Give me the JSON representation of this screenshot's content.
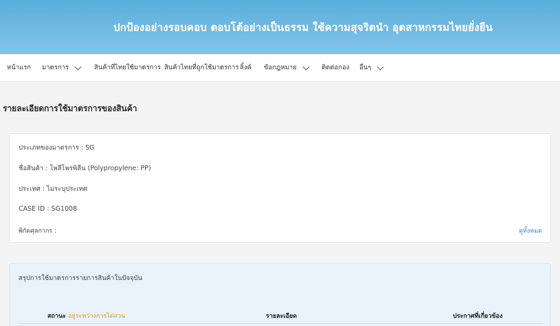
{
  "banner": {
    "title": "ปกป้องอย่างรอบคอบ ตอบโต้อย่างเป็นธรรม ใช้ความสุจริตนำ อุตสาหกรรมไทยยั่งยืน"
  },
  "nav": {
    "home": "หน้าแรก",
    "measures": "มาตรการ",
    "thai_goods_applying": "สินค้าที่ไทยใช้มาตรการ",
    "thai_goods_subjected": "สินค้าไทยที่ถูกใช้มาตรการ",
    "links": "ลิ้งค์",
    "laws": "ข้อกฎหมาย",
    "contact": "ติดต่อกอง",
    "others": "อื่นๆ"
  },
  "page": {
    "heading": "รายละเอียดการใช้มาตรการของสินค้า"
  },
  "details": {
    "measure_type": "ประเภทของมาตรการ : SG",
    "product_name": "ชื่อสินค้า : โพลีโพรพิลีน (Polypropylene: PP)",
    "country": "ประเทศ : ไม่ระบุประเทศ",
    "case_id": "CASE ID : SG1008",
    "tariff_code": "พิกัดศุลกากร :",
    "see_all": "ดูทั้งหมด"
  },
  "summary": {
    "title": "สรุปการใช้มาตรการรายการสินค้าในปัจจุบัน",
    "columns": {
      "status_label": "สถานะ",
      "status_value": "อยู่ระหว่างการไต่สวน",
      "details": "รายละเอียด",
      "announcements": "ประกาศที่เกี่ยวข้อง"
    }
  },
  "colors": {
    "banner": "#74bbe3",
    "link": "#3d84c6",
    "status": "#d69a1e"
  }
}
